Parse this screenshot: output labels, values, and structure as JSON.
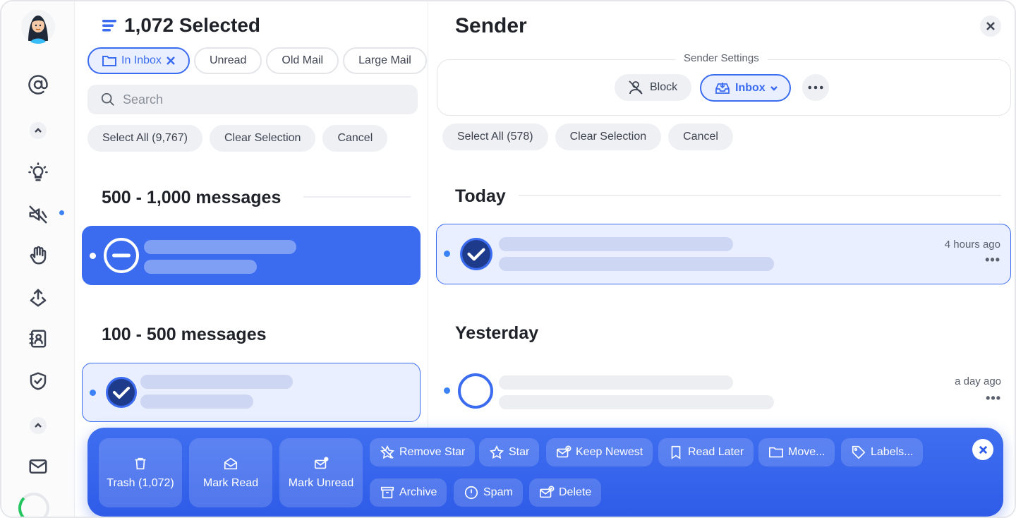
{
  "header": {
    "title": "1,072 Selected"
  },
  "filters": [
    {
      "label": "In Inbox",
      "active": true
    },
    {
      "label": "Unread",
      "active": false
    },
    {
      "label": "Old Mail",
      "active": false
    },
    {
      "label": "Large Mail",
      "active": false
    }
  ],
  "search": {
    "placeholder": "Search"
  },
  "left_actions": {
    "select_all": "Select All (9,767)",
    "clear": "Clear Selection",
    "cancel": "Cancel"
  },
  "groups": [
    {
      "heading": "500 - 1,000 messages"
    },
    {
      "heading": "100 - 500 messages"
    }
  ],
  "sender_panel": {
    "title": "Sender",
    "settings_label": "Sender Settings",
    "block_label": "Block",
    "inbox_label": "Inbox",
    "select_all": "Select All (578)",
    "clear": "Clear Selection",
    "cancel": "Cancel",
    "sections": [
      {
        "heading": "Today",
        "time": "4 hours ago"
      },
      {
        "heading": "Yesterday",
        "time": "a day ago"
      }
    ]
  },
  "action_bar": {
    "trash": "Trash (1,072)",
    "mark_read": "Mark Read",
    "mark_unread": "Mark Unread",
    "remove_star": "Remove Star",
    "star": "Star",
    "keep_newest": "Keep Newest",
    "read_later": "Read Later",
    "move": "Move...",
    "labels": "Labels...",
    "archive": "Archive",
    "spam": "Spam",
    "delete": "Delete"
  },
  "colors": {
    "accent": "#3b6cf0",
    "selected_bg": "#e9effe",
    "status_dot": "#3b82f6"
  }
}
